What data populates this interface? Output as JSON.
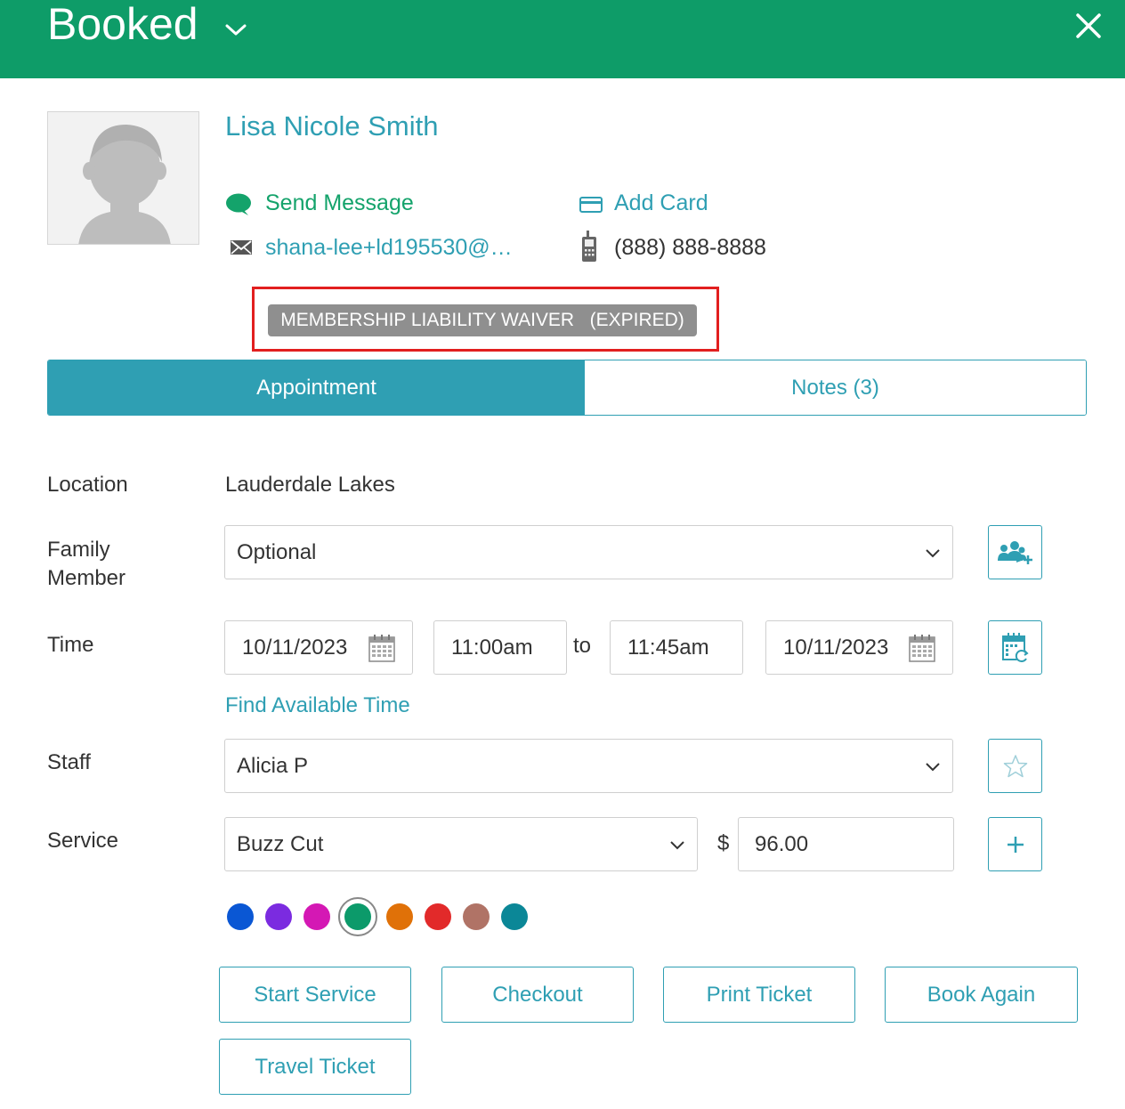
{
  "header": {
    "title": "Booked"
  },
  "client": {
    "name": "Lisa Nicole Smith",
    "send_message": "Send Message",
    "add_card": "Add Card",
    "email": "shana-lee+ld195530@…",
    "phone": "(888) 888-8888"
  },
  "waiver": {
    "label": "MEMBERSHIP LIABILITY WAIVER   (EXPIRED)"
  },
  "tabs": [
    {
      "label": "Appointment",
      "active": true
    },
    {
      "label": "Notes (3)",
      "active": false
    }
  ],
  "form": {
    "location_label": "Location",
    "location_value": "Lauderdale Lakes",
    "family_label_1": "Family",
    "family_label_2": "Member",
    "family_value": "Optional",
    "time_label": "Time",
    "start_date": "10/11/2023",
    "start_time": "11:00am",
    "to_label": "to",
    "end_time": "11:45am",
    "end_date": "10/11/2023",
    "find_time": "Find Available Time",
    "staff_label": "Staff",
    "staff_value": "Alicia P",
    "service_label": "Service",
    "service_value": "Buzz Cut",
    "currency": "$",
    "price": "96.00"
  },
  "colors": {
    "brand_green": "#0e9c68",
    "accent_teal": "#2f9fb3",
    "waiver_highlight": "#e21f1f",
    "swatches": [
      "#0a57d4",
      "#7b2be0",
      "#d418b4",
      "#0c9a6a",
      "#e07108",
      "#e22a2a",
      "#b07366",
      "#0b8797"
    ],
    "selected_swatch": 3
  },
  "actions": {
    "start_service": "Start Service",
    "checkout": "Checkout",
    "print_ticket": "Print Ticket",
    "book_again": "Book Again",
    "travel_ticket": "Travel Ticket"
  }
}
